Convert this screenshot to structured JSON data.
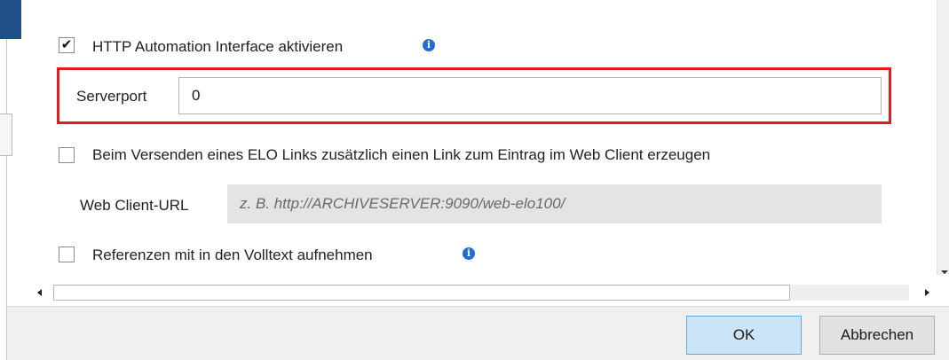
{
  "http_automation": {
    "checked": true,
    "label": "HTTP Automation Interface aktivieren",
    "info_icon": "info-icon"
  },
  "serverport": {
    "label": "Serverport",
    "value": "0"
  },
  "elo_link": {
    "checked": false,
    "label": "Beim Versenden eines ELO Links zusätzlich einen Link zum Eintrag im Web Client erzeugen"
  },
  "web_client_url": {
    "label": "Web Client-URL",
    "placeholder": "z. B. http://ARCHIVESERVER:9090/web-elo100/"
  },
  "references": {
    "checked": false,
    "label": "Referenzen mit in den Volltext aufnehmen",
    "info_icon": "info-icon"
  },
  "buttons": {
    "ok": "OK",
    "cancel": "Abbrechen"
  },
  "colors": {
    "highlight": "#e11b22",
    "info": "#1f6fd1",
    "accent": "#1e4f86",
    "primary_button": "#cce4f7"
  }
}
